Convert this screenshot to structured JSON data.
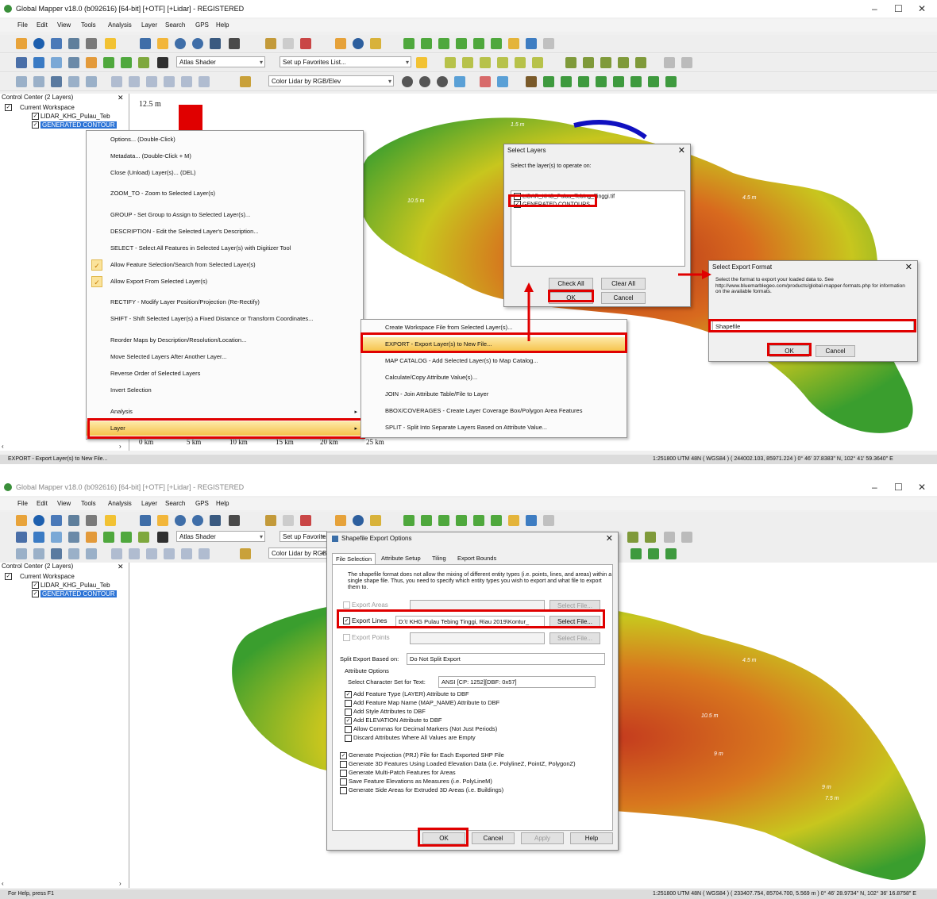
{
  "app": {
    "title": "Global Mapper v18.0 (b092616) [64-bit] [+OTF] [+Lidar] - REGISTERED",
    "menu": [
      "File",
      "Edit",
      "View",
      "Tools",
      "Analysis",
      "Layer",
      "Search",
      "GPS",
      "Help"
    ],
    "shader_combo": "Atlas Shader",
    "favorites_combo": "Set up Favorites List...",
    "lidar_combo": "Color Lidar by RGB/Elev",
    "window_controls": {
      "minimize": "–",
      "maximize": "☐",
      "close": "✕"
    }
  },
  "control_center": {
    "header": "Control Center (2 Layers)",
    "close": "✕",
    "workspace": "Current Workspace",
    "layers": [
      "LIDAR_KHG_Pulau_Teb",
      "GENERATED CONTOUR"
    ]
  },
  "panel1": {
    "legend_value": "12.5 m",
    "scale_labels": [
      "0 km",
      "5 km",
      "10 km",
      "15 km",
      "20 km",
      "25 km"
    ],
    "status_left": "EXPORT - Export Layer(s) to New File...",
    "status_right": "1:251800  UTM 48N ( WGS84 ) ( 244002.103, 85971.224 ) 0° 46' 37.8383\" N, 102° 41' 59.3640\" E",
    "contour_labels": [
      "1.5 m",
      "1.5 m",
      "4.5 m",
      "10.5 m",
      "10.5 m"
    ],
    "context_menu": [
      {
        "label": "Options... (Double-Click)",
        "checked": false
      },
      {
        "label": "Metadata... (Double-Click + M)",
        "checked": false
      },
      {
        "label": "Close (Unload) Layer(s)... (DEL)",
        "checked": false
      },
      {
        "label": "ZOOM_TO - Zoom to Selected Layer(s)",
        "checked": false
      },
      {
        "label": "GROUP - Set Group to Assign to Selected Layer(s)...",
        "checked": false
      },
      {
        "label": "DESCRIPTION - Edit the Selected Layer's Description...",
        "checked": false
      },
      {
        "label": "SELECT - Select All Features in Selected Layer(s) with Digitizer Tool",
        "checked": false
      },
      {
        "label": "Allow Feature Selection/Search from Selected Layer(s)",
        "checked": true
      },
      {
        "label": "Allow Export From Selected Layer(s)",
        "checked": true
      },
      {
        "label": "RECTIFY - Modify Layer Position/Projection (Re-Rectify)",
        "checked": false
      },
      {
        "label": "SHIFT - Shift Selected Layer(s) a Fixed Distance or Transform Coordinates...",
        "checked": false
      },
      {
        "label": "Reorder Maps by Description/Resolution/Location...",
        "checked": false
      },
      {
        "label": "Move Selected Layers After Another Layer...",
        "checked": false
      },
      {
        "label": "Reverse Order of Selected Layers",
        "checked": false
      },
      {
        "label": "Invert Selection",
        "checked": false
      },
      {
        "label": "Analysis",
        "checked": false
      },
      {
        "label": "Layer",
        "checked": false
      }
    ],
    "submenu": [
      "Create Workspace File from Selected Layer(s)...",
      "EXPORT - Export Layer(s) to New File...",
      "MAP CATALOG - Add Selected Layer(s) to Map Catalog...",
      "Calculate/Copy Attribute Value(s)...",
      "JOIN - Join Attribute Table/File to Layer",
      "BBOX/COVERAGES  - Create Layer Coverage Box/Polygon Area Features",
      "SPLIT - Split Into Separate Layers Based on Attribute Value..."
    ],
    "select_layers": {
      "title": "Select Layers",
      "prompt": "Select the layer(s) to operate on:",
      "items": [
        "LIDAR_KHG_Pulau_Tebing_Tinggi.tif",
        "GENERATED CONTOURS"
      ],
      "check_all": "Check All",
      "clear_all": "Clear All",
      "ok": "OK",
      "cancel": "Cancel"
    },
    "export_format": {
      "title": "Select Export Format",
      "prompt": "Select the format to export your loaded data to. See http://www.bluemarblegeo.com/products/global-mapper-formats.php for information on the available formats.",
      "format": "Shapefile",
      "ok": "OK",
      "cancel": "Cancel"
    }
  },
  "panel2": {
    "status_left": "For Help, press F1",
    "status_right": "1:251800  UTM 48N ( WGS84 ) ( 233407.754, 85704.700, 5.569 m ) 0° 46' 28.9734\" N, 102° 36' 16.8758\" E",
    "contour_labels": [
      "4.5 m",
      "10.5 m",
      "9 m",
      "3 m",
      "9 m",
      "7.5 m"
    ],
    "dialog": {
      "title": "Shapefile Export Options",
      "tabs": [
        "File Selection",
        "Attribute Setup",
        "Tiling",
        "Export Bounds"
      ],
      "intro": "The shapefile format does not allow the mixing of different entity types (i.e. points, lines, and areas) within a single shape file. Thus, you need to specify which entity types you wish to export and what file to export them to.",
      "export_areas": "Export Areas",
      "export_lines": "Export Lines",
      "export_points": "Export Points",
      "lines_path": "D:\\! KHG Pulau Tebing Tinggi, Riau 2019\\Kontur_",
      "select_file": "Select File...",
      "split_label": "Split Export Based on:",
      "split_value": "Do Not Split Export",
      "attr_header": "Attribute Options",
      "charset_label": "Select Character Set for Text:",
      "charset_value": "ANSI [CP: 1252][DBF: 0x57]",
      "attr_options": [
        {
          "label": "Add Feature Type (LAYER) Attribute to DBF",
          "checked": true
        },
        {
          "label": "Add Feature Map Name (MAP_NAME) Attribute to DBF",
          "checked": false
        },
        {
          "label": "Add Style Attributes to DBF",
          "checked": false
        },
        {
          "label": "Add ELEVATION Attribute to DBF",
          "checked": true
        },
        {
          "label": "Allow Commas for Decimal Markers (Not Just Periods)",
          "checked": false
        },
        {
          "label": "Discard Attributes Where All Values are Empty",
          "checked": false
        }
      ],
      "gen_options": [
        {
          "label": "Generate Projection (PRJ) File for Each Exported SHP File",
          "checked": true
        },
        {
          "label": "Generate 3D Features Using Loaded Elevation Data (i.e. PolylineZ, PointZ, PolygonZ)",
          "checked": false
        },
        {
          "label": "Generate Multi-Patch Features for Areas",
          "checked": false
        },
        {
          "label": "Save Feature Elevations as Measures (i.e. PolyLineM)",
          "checked": false
        },
        {
          "label": "Generate Side Areas for Extruded 3D Areas (i.e. Buildings)",
          "checked": false
        }
      ],
      "ok": "OK",
      "cancel": "Cancel",
      "apply": "Apply",
      "help": "Help"
    }
  },
  "colors": {
    "highlight_box": "#e00000",
    "selection_blue": "#2b73d6",
    "terrain_low": "#2e9e2e",
    "terrain_mid": "#d8d21a",
    "terrain_high": "#c43a1e"
  }
}
